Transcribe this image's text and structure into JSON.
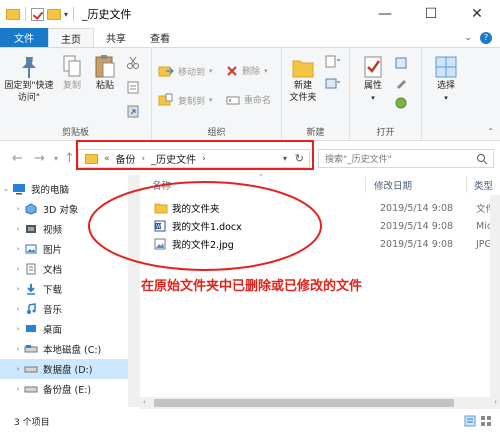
{
  "window": {
    "title": "_历史文件",
    "minimize": "—",
    "maximize": "☐",
    "close": "✕"
  },
  "tabs": [
    {
      "label": "文件"
    },
    {
      "label": "主页"
    },
    {
      "label": "共享"
    },
    {
      "label": "查看"
    }
  ],
  "ribbon": {
    "clipboard": {
      "label": "剪贴板",
      "pin": "固定到\"快速访问\"",
      "copy": "复制",
      "paste": "粘贴"
    },
    "organize": {
      "label": "组织",
      "move_to": "移动到",
      "copy_to": "复制到",
      "delete": "删除",
      "rename": "重命名"
    },
    "new": {
      "label": "新建",
      "new_folder": "新建\n文件夹"
    },
    "open": {
      "label": "打开",
      "properties": "属性"
    },
    "select": {
      "label": "选择"
    }
  },
  "address": {
    "crumbs": [
      "备份",
      "_历史文件"
    ],
    "prefix": "«",
    "search_placeholder": "搜索\"_历史文件\""
  },
  "sidebar": {
    "items": [
      {
        "label": "我的电脑",
        "icon": "computer-icon"
      },
      {
        "label": "3D 对象",
        "icon": "3d-objects-icon"
      },
      {
        "label": "视频",
        "icon": "video-icon"
      },
      {
        "label": "图片",
        "icon": "picture-icon"
      },
      {
        "label": "文档",
        "icon": "document-icon"
      },
      {
        "label": "下载",
        "icon": "download-icon"
      },
      {
        "label": "音乐",
        "icon": "music-icon"
      },
      {
        "label": "桌面",
        "icon": "desktop-icon"
      },
      {
        "label": "本地磁盘 (C:)",
        "icon": "drive-icon"
      },
      {
        "label": "数据盘 (D:)",
        "icon": "drive-icon"
      },
      {
        "label": "备份盘 (E:)",
        "icon": "drive-icon"
      }
    ]
  },
  "columns": {
    "name": "名称",
    "date": "修改日期",
    "type": "类型"
  },
  "files": [
    {
      "name": "我的文件夹",
      "date": "2019/5/14 9:08",
      "type": "文件",
      "icon": "folder-icon"
    },
    {
      "name": "我的文件1.docx",
      "date": "2019/5/14 9:08",
      "type": "Micr",
      "icon": "word-doc-icon"
    },
    {
      "name": "我的文件2.jpg",
      "date": "2019/5/14 9:08",
      "type": "JPG",
      "icon": "image-file-icon"
    }
  ],
  "annotation": "在原始文件夹中已删除或已修改的文件",
  "status": {
    "count": "3 个项目"
  },
  "colors": {
    "accent": "#1979ca",
    "highlight_red": "#e4221b",
    "selection": "#cce8ff"
  }
}
